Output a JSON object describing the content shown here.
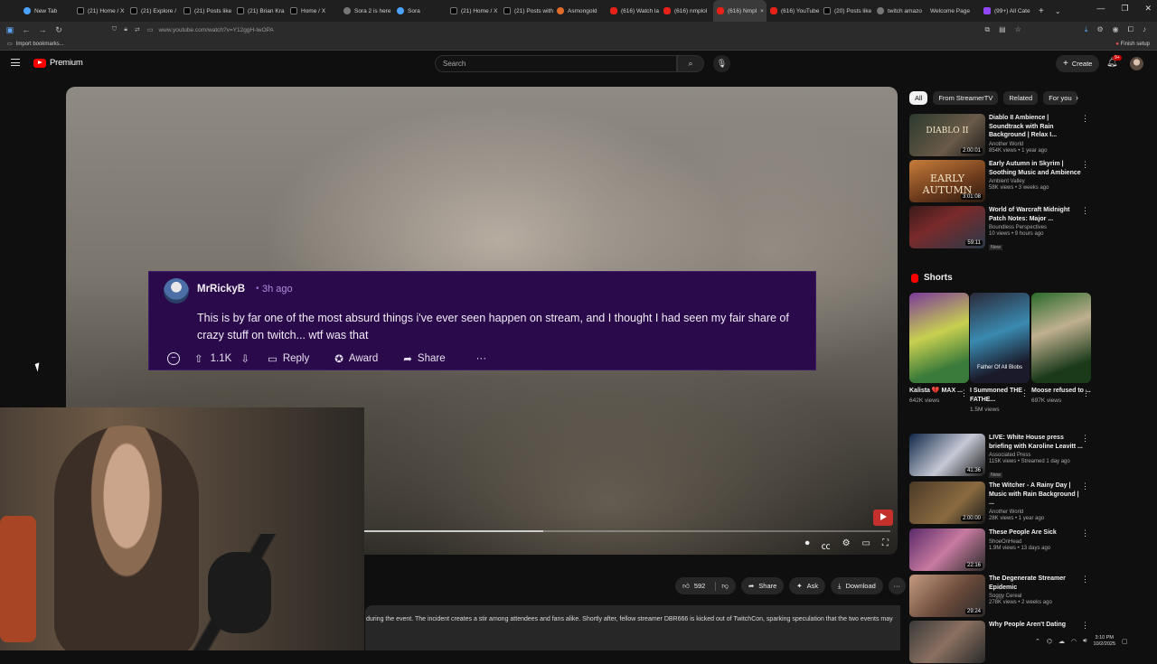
{
  "browser": {
    "tabs": [
      {
        "label": "New Tab",
        "icon": "blue"
      },
      {
        "label": "(21) Home / X",
        "icon": "x"
      },
      {
        "label": "(21) Explore /",
        "icon": "x"
      },
      {
        "label": "(21) Posts like",
        "icon": "x"
      },
      {
        "label": "(21) Brian Kra",
        "icon": "x"
      },
      {
        "label": "Home / X",
        "icon": "x"
      },
      {
        "label": "Sora 2 is here",
        "icon": "gray"
      },
      {
        "label": "Sora",
        "icon": "blue"
      },
      {
        "label": "(21) Home / X",
        "icon": "x"
      },
      {
        "label": "(21) Posts with",
        "icon": "x"
      },
      {
        "label": "Asmongold",
        "icon": "orange"
      },
      {
        "label": "(616) Watch la",
        "icon": "yt"
      },
      {
        "label": "(616) nmplol",
        "icon": "yt"
      },
      {
        "label": "(616) Nmpl",
        "icon": "yt",
        "active": true
      },
      {
        "label": "(616) YouTube",
        "icon": "yt"
      },
      {
        "label": "(20) Posts like",
        "icon": "x"
      },
      {
        "label": "twitch amazo",
        "icon": "gray"
      },
      {
        "label": "Welcome Page",
        "icon": "none"
      },
      {
        "label": "(99+) All Cate",
        "icon": "tw"
      }
    ],
    "url": "www.youtube.com/watch?v=Y12ggH-lwOPA",
    "bookmarks_label": "Import bookmarks...",
    "finish_setup": "Finish setup"
  },
  "youtube": {
    "logo_text": "Premium",
    "search_placeholder": "Search",
    "create_label": "Create",
    "notif_badge": "9+"
  },
  "comment": {
    "username": "MrRickyB",
    "time": "3h ago",
    "body": "This is by far one of the most absurd things i've ever seen happen on stream, and I thought I had seen my fair share of crazy stuff on twitch... wtf was that",
    "votes": "1.1K",
    "reply_label": "Reply",
    "award_label": "Award",
    "share_label": "Share"
  },
  "player": {
    "progress": 0.34
  },
  "actions": {
    "likes": "592",
    "share": "Share",
    "ask": "Ask",
    "download": "Download"
  },
  "description": {
    "text": "during the event. The incident creates a stir among attendees and fans alike. Shortly after, fellow streamer DBR666 is kicked out of TwitchCon, sparking speculation that the two events may"
  },
  "sidebar": {
    "chips": [
      "All",
      "From StreamerTV",
      "Related",
      "For you"
    ],
    "recs_top": [
      {
        "title": "Diablo II Ambience | Soundtrack with Rain Background | Relax I...",
        "channel": "Another World",
        "stats": "854K views • 1 year ago",
        "duration": "2:00:01",
        "thumb_text": "DIABLO II"
      },
      {
        "title": "Early Autumn in Skyrim | Soothing Music and Ambience",
        "channel": "Ambient Valley",
        "stats": "58K views • 3 weeks ago",
        "duration": "3:01:08",
        "thumb_text": "EARLY AUTUMN"
      },
      {
        "title": "World of Warcraft Midnight Patch Notes: Major ...",
        "channel": "Boundless Perspectives",
        "stats": "10 views • 9 hours ago",
        "duration": "59:11",
        "badge": "New"
      }
    ],
    "shorts_title": "Shorts",
    "shorts": [
      {
        "title": "Kalista 💔 MAX ...",
        "views": "642K views",
        "overlay": ""
      },
      {
        "title": "I Summoned THE FATHE...",
        "views": "1.5M views",
        "overlay": "Father Of All Blobs"
      },
      {
        "title": "Moose refused to ...",
        "views": "697K views",
        "overlay": ""
      }
    ],
    "recs_bottom": [
      {
        "title": "LIVE: White House press briefing with Karoline Leavitt ...",
        "channel": "Associated Press",
        "stats": "115K views • Streamed 1 day ago",
        "duration": "41:36",
        "badge": "New"
      },
      {
        "title": "The Witcher - A Rainy Day | Music with Rain Background | ...",
        "channel": "Another World",
        "stats": "28K views • 1 year ago",
        "duration": "2:00:00"
      },
      {
        "title": "These People Are Sick",
        "channel": "ShoeOnHead",
        "stats": "1.9M views • 13 days ago",
        "duration": "22:16"
      },
      {
        "title": "The Degenerate Streamer Epidemic",
        "channel": "Soggy Cereal",
        "stats": "278K views • 2 weeks ago",
        "duration": "29:24"
      },
      {
        "title": "Why People Aren't Dating",
        "channel": "",
        "stats": "",
        "duration": ""
      }
    ]
  },
  "taskbar": {
    "time": "3:10 PM",
    "date": "10/2/2025"
  }
}
